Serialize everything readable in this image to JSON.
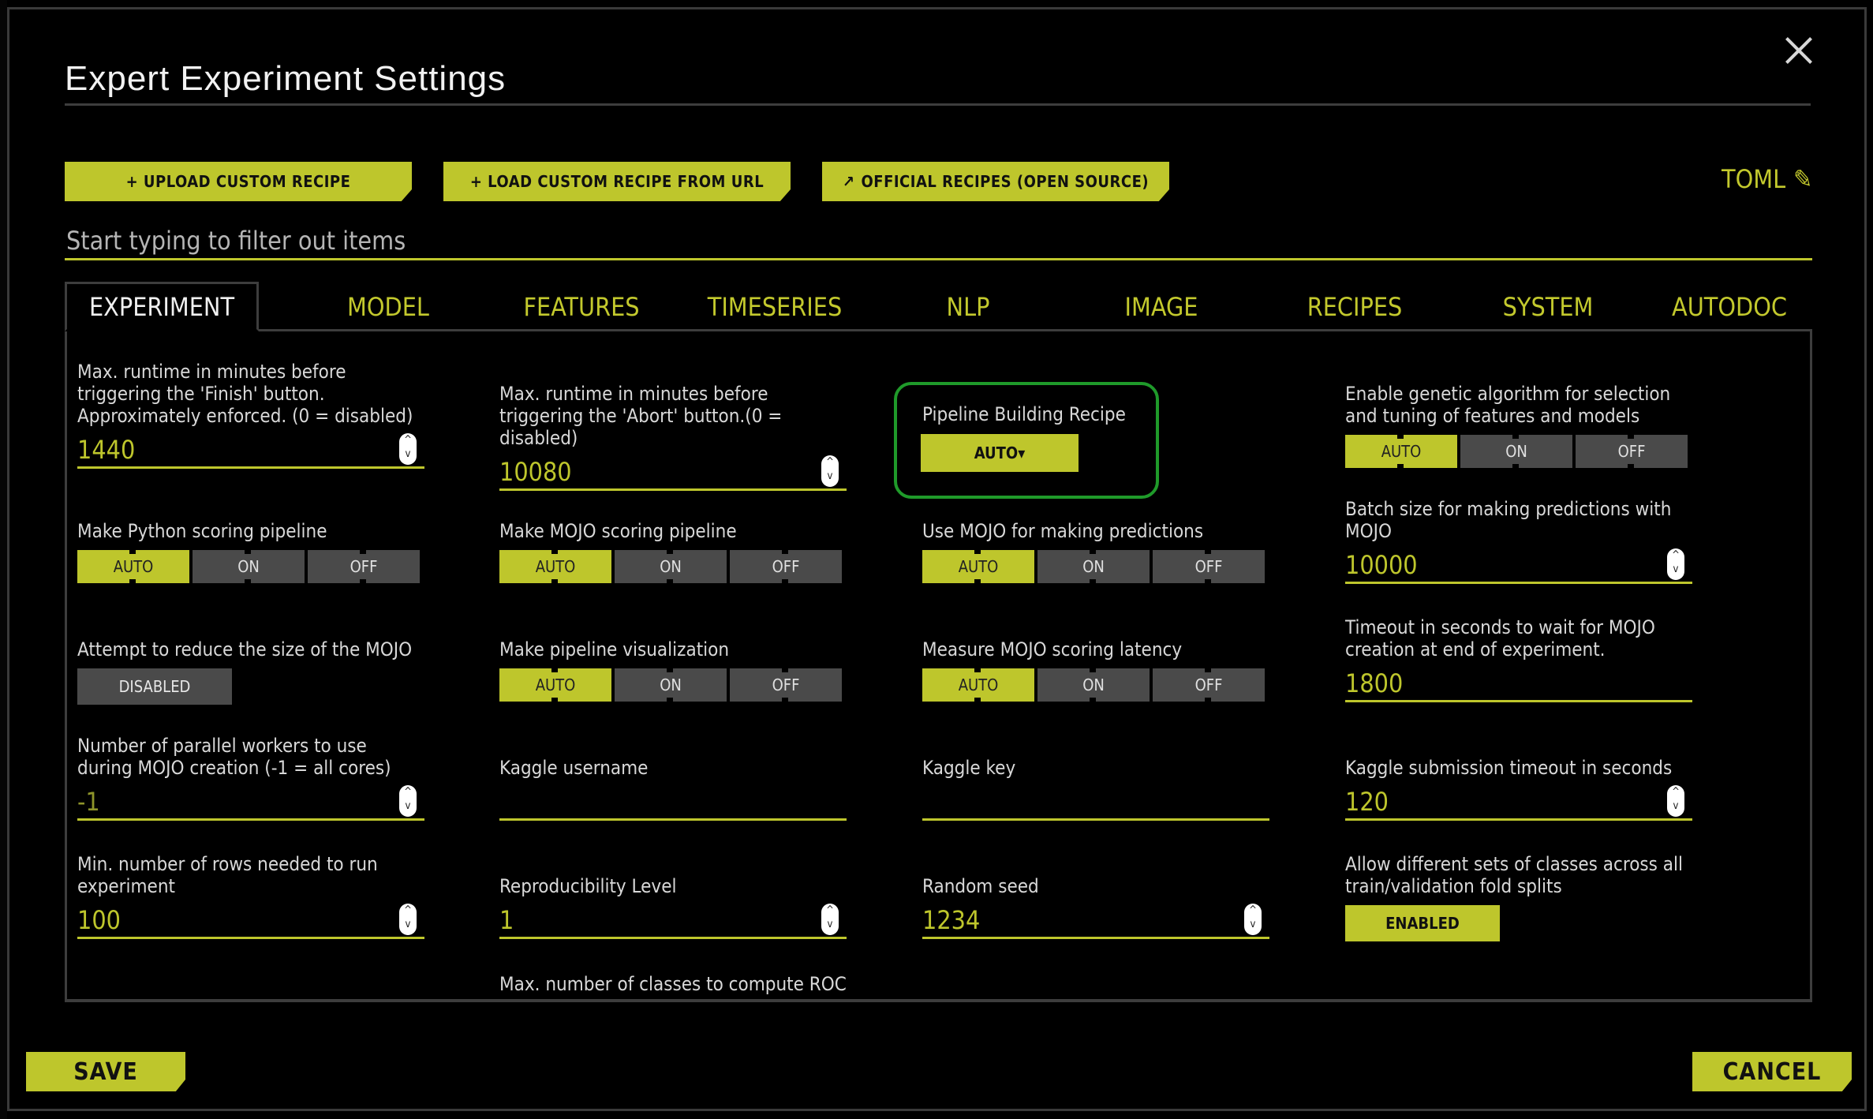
{
  "dialog": {
    "title": "Expert Experiment Settings",
    "close_icon": "close-icon"
  },
  "toolbar": {
    "upload_recipe": "+ UPLOAD CUSTOM RECIPE",
    "load_recipe_url": "+ LOAD CUSTOM RECIPE FROM URL",
    "official_recipes": "OFFICIAL RECIPES (OPEN SOURCE)",
    "official_recipes_icon": "external-link-icon",
    "toml": "TOML",
    "toml_icon": "pencil-icon"
  },
  "filter": {
    "placeholder": "Start typing to filter out items",
    "value": ""
  },
  "tabs": [
    {
      "label": "EXPERIMENT",
      "active": true
    },
    {
      "label": "MODEL"
    },
    {
      "label": "FEATURES"
    },
    {
      "label": "TIMESERIES"
    },
    {
      "label": "NLP"
    },
    {
      "label": "IMAGE"
    },
    {
      "label": "RECIPES"
    },
    {
      "label": "SYSTEM"
    },
    {
      "label": "AUTODOC"
    }
  ],
  "toggle_options": [
    "AUTO",
    "ON",
    "OFF"
  ],
  "settings": {
    "max_runtime_finish": {
      "label": "Max. runtime in minutes before triggering the 'Finish' button. Approximately enforced. (0 = disabled)",
      "value": "1440"
    },
    "max_runtime_abort": {
      "label": "Max. runtime in minutes before triggering the 'Abort' button.(0 = disabled)",
      "value": "10080"
    },
    "pipeline_recipe": {
      "label": "Pipeline Building Recipe",
      "value": "AUTO▾"
    },
    "genetic_algorithm": {
      "label": "Enable genetic algorithm for selection and tuning of features and models",
      "selected": "AUTO"
    },
    "python_scoring": {
      "label": "Make Python scoring pipeline",
      "selected": "AUTO"
    },
    "mojo_scoring": {
      "label": "Make MOJO scoring pipeline",
      "selected": "AUTO"
    },
    "mojo_predictions": {
      "label": "Use MOJO for making predictions",
      "selected": "AUTO"
    },
    "mojo_batch_size": {
      "label": "Batch size for making predictions with MOJO",
      "value": "10000"
    },
    "reduce_mojo": {
      "label": "Attempt to reduce the size of the MOJO",
      "value": "DISABLED"
    },
    "pipeline_viz": {
      "label": "Make pipeline visualization",
      "selected": "AUTO"
    },
    "mojo_latency": {
      "label": "Measure MOJO scoring latency",
      "selected": "AUTO"
    },
    "mojo_timeout": {
      "label": "Timeout in seconds to wait for MOJO creation at end of experiment.",
      "value": "1800"
    },
    "mojo_workers": {
      "label": "Number of parallel workers to use during MOJO creation (-1 = all cores)",
      "value": "-1"
    },
    "kaggle_username": {
      "label": "Kaggle username",
      "value": ""
    },
    "kaggle_key": {
      "label": "Kaggle key",
      "value": ""
    },
    "kaggle_timeout": {
      "label": "Kaggle submission timeout in seconds",
      "value": "120"
    },
    "min_rows": {
      "label": "Min. number of rows needed to run experiment",
      "value": "100"
    },
    "reproducibility": {
      "label": "Reproducibility Level",
      "value": "1"
    },
    "random_seed": {
      "label": "Random seed",
      "value": "1234"
    },
    "class_sets": {
      "label": "Allow different sets of classes across all train/validation fold splits",
      "value": "ENABLED"
    },
    "max_classes_roc": {
      "label": "Max. number of classes to compute ROC"
    }
  },
  "footer": {
    "save": "SAVE",
    "cancel": "CANCEL"
  },
  "colors": {
    "accent": "#bec62c",
    "highlight": "#1f9a2a",
    "toggle_off": "#4a4a4a"
  }
}
